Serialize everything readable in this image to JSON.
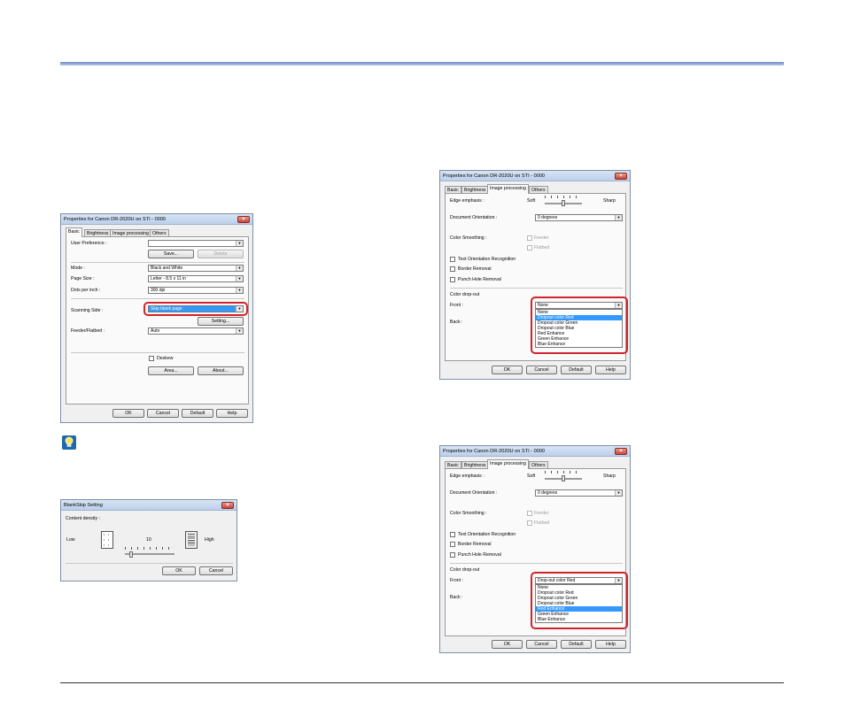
{
  "dialog1": {
    "title": "Properties for Canon DR-2020U on STI - 0000",
    "tabs": [
      "Basic",
      "Brightness",
      "Image processing",
      "Others"
    ],
    "user_preference_label": "User Preference :",
    "save_button": "Save...",
    "delete_button": "Delete",
    "mode_label": "Mode :",
    "mode_value": "Black and White",
    "page_size_label": "Page Size :",
    "page_size_value": "Letter - 8.5 x 11 in",
    "dpi_label": "Dots per inch :",
    "dpi_value": "300 dpi",
    "scanning_side_label": "Scanning Side :",
    "scanning_side_value": "Skip blank page",
    "setting_button": "Setting...",
    "feeder_label": "Feeder/Flatbed :",
    "feeder_value": "Auto",
    "deskew_label": "Deskew",
    "area_button": "Area...",
    "about_button": "About...",
    "ok": "OK",
    "cancel": "Cancel",
    "default": "Default",
    "help": "Help"
  },
  "blankskip": {
    "title": "BlankSkip Setting",
    "content_density_label": "Content density :",
    "low_label": "Low",
    "high_label": "High",
    "value": "10",
    "ok": "OK",
    "cancel": "Cancel"
  },
  "image_dialog": {
    "title": "Properties for Canon DR-2020U on STI - 0000",
    "tabs": [
      "Basic",
      "Brightness",
      "Image processing",
      "Others"
    ],
    "edge_label": "Edge emphasis :",
    "soft_label": "Soft",
    "sharp_label": "Sharp",
    "orientation_label": "Document Orientation :",
    "orientation_value": "0 degrees",
    "smoothing_label": "Color Smoothing :",
    "feeder_label": "Feeder",
    "flatbed_label": "Flatbed",
    "text_orientation_label": "Text Orientation Recognition",
    "border_removal_label": "Border Removal",
    "punch_hole_label": "Punch Hole Removal",
    "dropout_label": "Color drop-out",
    "front_label": "Front :",
    "back_label": "Back :",
    "options": [
      "None",
      "Dropout color Red",
      "Dropout color Green",
      "Dropout color Blue",
      "Red Enhance",
      "Green Enhance",
      "Blue Enhance"
    ],
    "ok": "OK",
    "cancel": "Cancel",
    "default": "Default",
    "help": "Help"
  },
  "dialog3": {
    "front_value": "None",
    "highlighted_option": "Dropout color Red"
  },
  "dialog4": {
    "front_value": "Drop-out color Red",
    "highlighted_option": "Red Enhance"
  },
  "colors": {
    "header_rule": "#6d88c9",
    "highlight_ring": "#d0242a",
    "selection": "#3399ff"
  }
}
